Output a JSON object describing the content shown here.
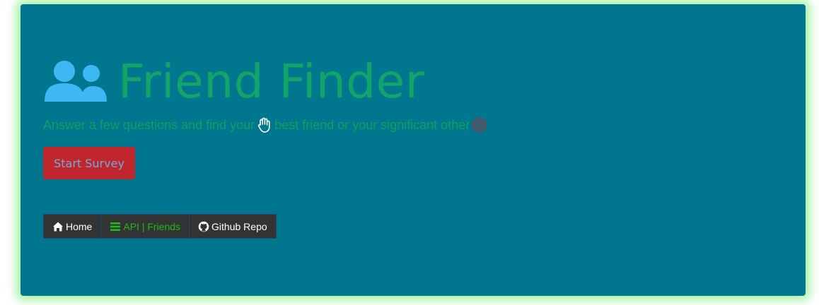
{
  "header": {
    "title": "Friend Finder",
    "title_icon": "users-icon",
    "subtitle_part1": "Answer a few questions and find your",
    "subtitle_part2": "best friend or your significant other",
    "hand_icon": "hand-paper-icon",
    "heart_icon": "heart-icon"
  },
  "actions": {
    "start_label": "Start Survey"
  },
  "nav": [
    {
      "label": "Home",
      "icon": "home-icon"
    },
    {
      "label": "API | Friends",
      "icon": "bars-icon"
    },
    {
      "label": "Github Repo",
      "icon": "github-icon"
    }
  ],
  "colors": {
    "panel": "#00778f",
    "title": "#11a56a",
    "button": "#c0272d",
    "nav_bg": "#333333",
    "accent_green": "#1dbb1d"
  }
}
